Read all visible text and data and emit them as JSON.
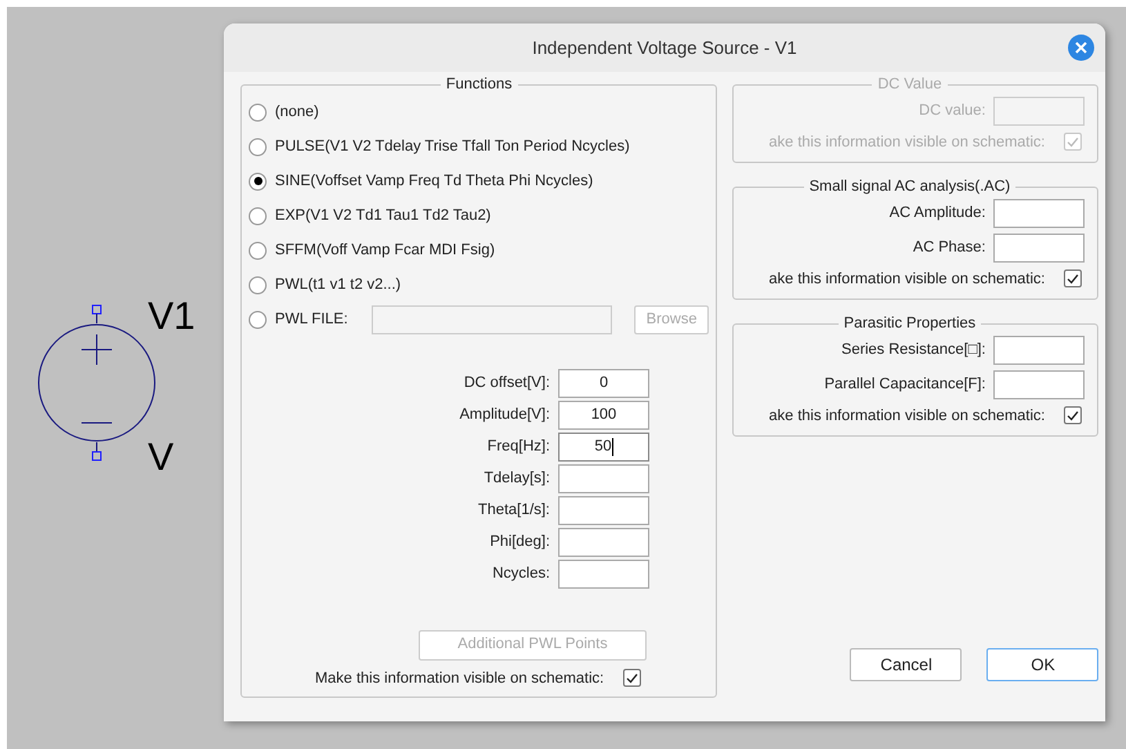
{
  "schematic": {
    "name": "V1",
    "value": "V"
  },
  "window": {
    "title": "Independent Voltage Source - V1"
  },
  "functions": {
    "title": "Functions",
    "options": [
      {
        "label": "(none)",
        "selected": false
      },
      {
        "label": "PULSE(V1 V2 Tdelay Trise Tfall Ton Period Ncycles)",
        "selected": false
      },
      {
        "label": "SINE(Voffset Vamp Freq Td Theta Phi Ncycles)",
        "selected": true
      },
      {
        "label": "EXP(V1 V2 Td1 Tau1 Td2 Tau2)",
        "selected": false
      },
      {
        "label": "SFFM(Voff Vamp Fcar MDI Fsig)",
        "selected": false
      },
      {
        "label": "PWL(t1 v1 t2 v2...)",
        "selected": false
      },
      {
        "label": "PWL FILE:",
        "selected": false,
        "kind": "file"
      }
    ],
    "browse": {
      "label": "Browse",
      "disabled": true
    },
    "params": [
      {
        "label": "DC offset[V]:",
        "value": "0",
        "focused": false
      },
      {
        "label": "Amplitude[V]:",
        "value": "100",
        "focused": false
      },
      {
        "label": "Freq[Hz]:",
        "value": "50",
        "focused": true
      },
      {
        "label": "Tdelay[s]:",
        "focused": false
      },
      {
        "label": "Theta[1/s]:",
        "focused": false
      },
      {
        "label": "Phi[deg]:",
        "focused": false
      },
      {
        "label": "Ncycles:",
        "focused": false
      }
    ],
    "pwl_points": {
      "label": "Additional PWL Points",
      "disabled": true
    },
    "visible": {
      "label": "Make this information visible on schematic:",
      "checked": true
    }
  },
  "groups": [
    {
      "title": "DC Value",
      "disabled": true,
      "fields": [
        {
          "label": "DC value:"
        }
      ],
      "visible": {
        "label": "ake this information visible on schematic:",
        "checked": true
      }
    },
    {
      "title": "Small signal AC analysis(.AC)",
      "disabled": false,
      "fields": [
        {
          "label": "AC Amplitude:"
        },
        {
          "label": "AC Phase:"
        }
      ],
      "visible": {
        "label": "ake this information visible on schematic:",
        "checked": true
      }
    },
    {
      "title": "Parasitic Properties",
      "disabled": false,
      "fields": [
        {
          "label": "Series Resistance[□]:"
        },
        {
          "label": "Parallel Capacitance[F]:"
        }
      ],
      "visible": {
        "label": "ake this information visible on schematic:",
        "checked": true
      }
    }
  ],
  "buttons": [
    {
      "label": "Cancel",
      "default": false
    },
    {
      "label": "OK",
      "default": true
    }
  ]
}
